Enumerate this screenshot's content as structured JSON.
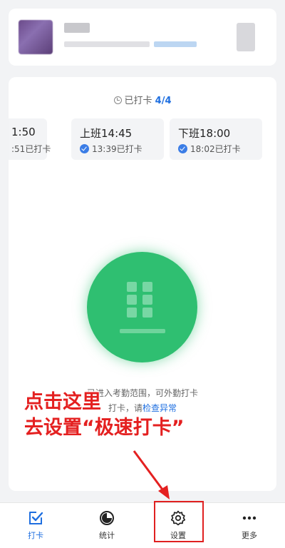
{
  "status": {
    "label": "已打卡",
    "count": "4/4"
  },
  "shifts": [
    {
      "time": "1:50",
      "record": ":51已打卡"
    },
    {
      "time": "上班14:45",
      "record": "13:39已打卡"
    },
    {
      "time": "下班18:00",
      "record": "18:02已打卡"
    }
  ],
  "info": {
    "line1": "已进入考勤范围，可外勤打卡",
    "line2_prefix": "打卡，请",
    "line2_link": "检查异常"
  },
  "annotation": {
    "line1": "点击这里",
    "line2": "去设置“极速打卡”"
  },
  "tabs": [
    {
      "label": "打卡",
      "icon": "check-icon"
    },
    {
      "label": "统计",
      "icon": "pie-chart-icon"
    },
    {
      "label": "设置",
      "icon": "gear-icon"
    },
    {
      "label": "更多",
      "icon": "more-icon"
    }
  ],
  "colors": {
    "accent": "#1f6fe0",
    "punch": "#2fbf71",
    "annotation": "#e42020"
  }
}
